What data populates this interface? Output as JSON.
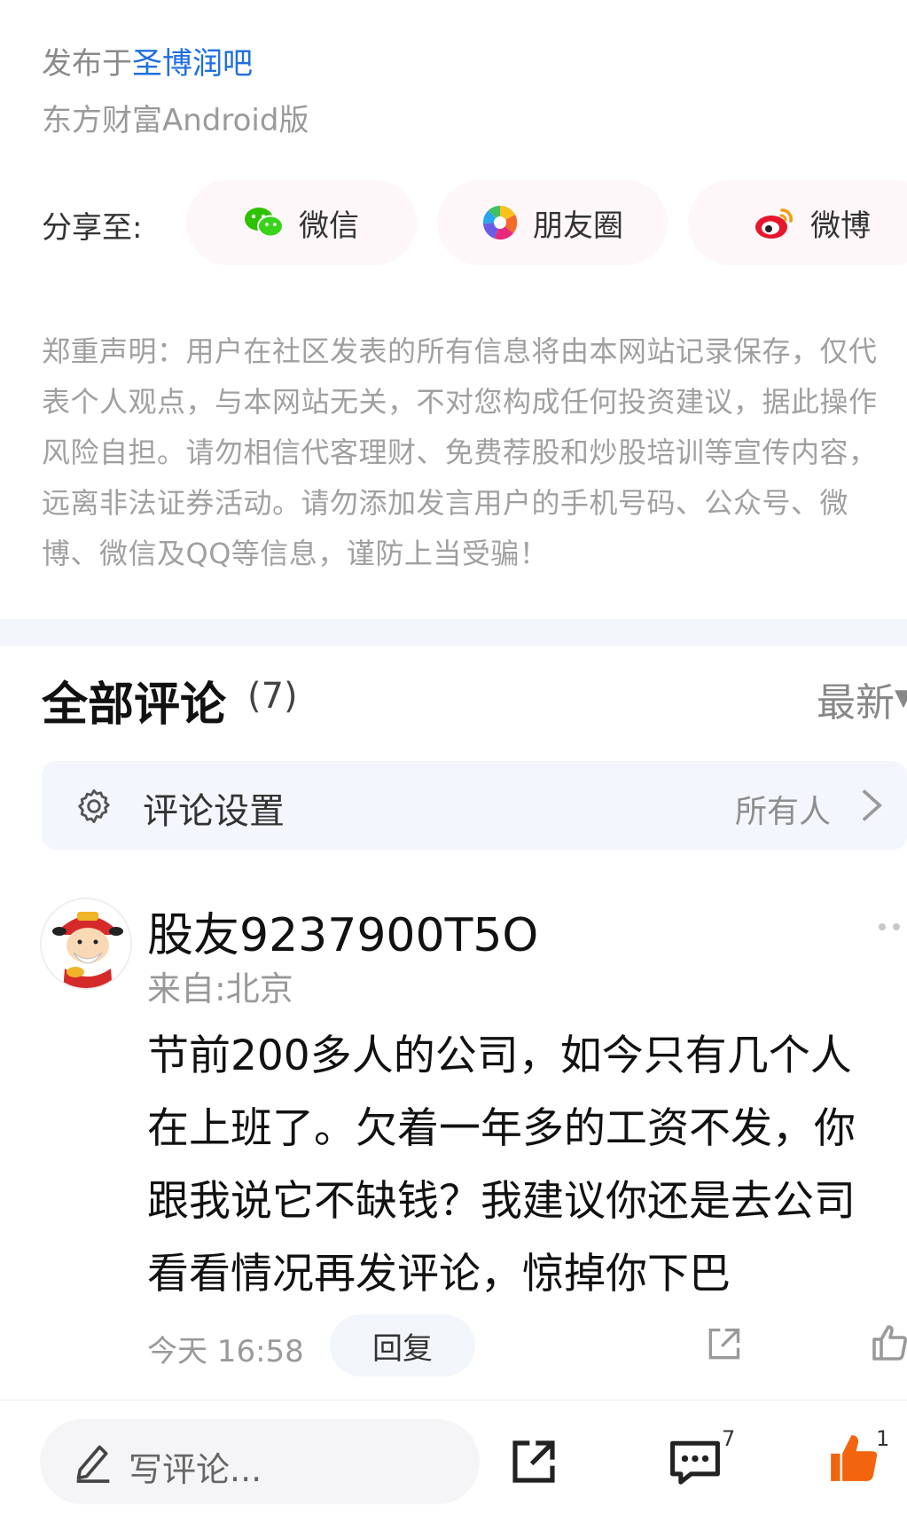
{
  "post_meta": {
    "published_prefix": "发布于",
    "forum_name": "圣博润吧",
    "client": "东方财富Android版"
  },
  "share": {
    "label": "分享至:",
    "wechat": "微信",
    "moments": "朋友圈",
    "weibo": "微博"
  },
  "disclaimer": "郑重声明：用户在社区发表的所有信息将由本网站记录保存，仅代表个人观点，与本网站无关，不对您构成任何投资建议，据此操作风险自担。请勿相信代客理财、免费荐股和炒股培训等宣传内容，远离非法证券活动。请勿添加发言用户的手机号码、公众号、微博、微信及QQ等信息，谨防上当受骗！",
  "comments": {
    "title": "全部评论",
    "count": "(7)",
    "sort": "最新",
    "settings_label": "评论设置",
    "settings_value": "所有人",
    "items": [
      {
        "username": "股友9237900T5O",
        "location": "来自:北京",
        "body": "节前200多人的公司，如今只有几个人\n在上班了。欠着一年多的工资不发，你\n跟我说它不缺钱？我建议你还是去公司\n看看情况再发评论，惊掉你下巴",
        "time": "今天 16:58",
        "reply_label": "回复"
      }
    ]
  },
  "bottom_bar": {
    "write_placeholder": "写评论...",
    "comment_count": "7",
    "like_count": "1"
  },
  "colors": {
    "link": "#1f6fe0",
    "like_orange": "#f2640e"
  }
}
